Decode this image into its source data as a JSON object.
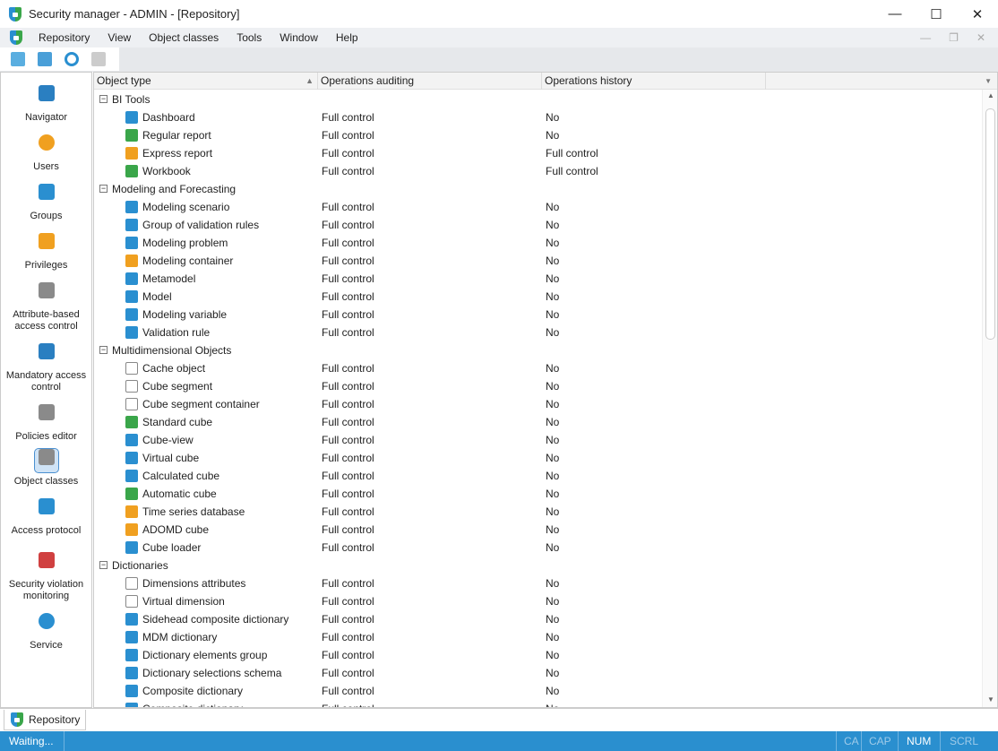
{
  "window": {
    "title": "Security manager - ADMIN - [Repository]",
    "minimize": "—",
    "maximize": "☐",
    "close": "✕"
  },
  "menu": [
    "Repository",
    "View",
    "Object classes",
    "Tools",
    "Window",
    "Help"
  ],
  "mdi": {
    "minimize": "—",
    "restore": "❐",
    "close": "✕"
  },
  "sidebar": [
    {
      "label": "Navigator",
      "icon": "navigator-icon",
      "color": "#2a7fc1"
    },
    {
      "label": "Users",
      "icon": "user-icon",
      "color": "#f0a020"
    },
    {
      "label": "Groups",
      "icon": "groups-icon",
      "color": "#2a8fd0"
    },
    {
      "label": "Privileges",
      "icon": "key-icon",
      "color": "#f0a020"
    },
    {
      "label": "Attribute-based access control",
      "icon": "gear-tag-icon",
      "color": "#8a8a8a"
    },
    {
      "label": "Mandatory access control",
      "icon": "stamp-icon",
      "color": "#2a7fc1"
    },
    {
      "label": "Policies editor",
      "icon": "gear-shield-icon",
      "color": "#8a8a8a"
    },
    {
      "label": "Object classes",
      "icon": "gear-document-icon",
      "color": "#8a8a8a"
    },
    {
      "label": "Access protocol",
      "icon": "log-icon",
      "color": "#2a8fd0"
    },
    {
      "label": "Security violation monitoring",
      "icon": "violation-icon",
      "color": "#d04040"
    },
    {
      "label": "Service",
      "icon": "service-gear-icon",
      "color": "#2a8fd0"
    }
  ],
  "grid": {
    "columns": [
      "Object type",
      "Operations auditing",
      "Operations history"
    ],
    "rows": [
      {
        "group": "BI Tools"
      },
      {
        "name": "Dashboard",
        "audit": "Full control",
        "history": "No",
        "color": "#2a8fd0"
      },
      {
        "name": "Regular report",
        "audit": "Full control",
        "history": "No",
        "color": "#3aa64a"
      },
      {
        "name": "Express report",
        "audit": "Full control",
        "history": "Full control",
        "color": "#f0a020"
      },
      {
        "name": "Workbook",
        "audit": "Full control",
        "history": "Full control",
        "color": "#3aa64a"
      },
      {
        "group": "Modeling and Forecasting"
      },
      {
        "name": "Modeling scenario",
        "audit": "Full control",
        "history": "No",
        "color": "#2a8fd0"
      },
      {
        "name": "Group of validation rules",
        "audit": "Full control",
        "history": "No",
        "color": "#2a8fd0"
      },
      {
        "name": "Modeling problem",
        "audit": "Full control",
        "history": "No",
        "color": "#2a8fd0"
      },
      {
        "name": "Modeling container",
        "audit": "Full control",
        "history": "No",
        "color": "#f0a020"
      },
      {
        "name": "Metamodel",
        "audit": "Full control",
        "history": "No",
        "color": "#2a8fd0"
      },
      {
        "name": "Model",
        "audit": "Full control",
        "history": "No",
        "color": "#2a8fd0"
      },
      {
        "name": "Modeling variable",
        "audit": "Full control",
        "history": "No",
        "color": "#2a8fd0"
      },
      {
        "name": "Validation rule",
        "audit": "Full control",
        "history": "No",
        "color": "#2a8fd0"
      },
      {
        "group": "Multidimensional Objects"
      },
      {
        "name": "Cache object",
        "audit": "Full control",
        "history": "No",
        "color": "#ffffff"
      },
      {
        "name": "Cube segment",
        "audit": "Full control",
        "history": "No",
        "color": "#ffffff"
      },
      {
        "name": "Cube segment container",
        "audit": "Full control",
        "history": "No",
        "color": "#ffffff"
      },
      {
        "name": "Standard cube",
        "audit": "Full control",
        "history": "No",
        "color": "#3aa64a"
      },
      {
        "name": "Cube-view",
        "audit": "Full control",
        "history": "No",
        "color": "#2a8fd0"
      },
      {
        "name": "Virtual cube",
        "audit": "Full control",
        "history": "No",
        "color": "#2a8fd0"
      },
      {
        "name": "Calculated cube",
        "audit": "Full control",
        "history": "No",
        "color": "#2a8fd0"
      },
      {
        "name": "Automatic cube",
        "audit": "Full control",
        "history": "No",
        "color": "#3aa64a"
      },
      {
        "name": "Time series database",
        "audit": "Full control",
        "history": "No",
        "color": "#f0a020"
      },
      {
        "name": "ADOMD cube",
        "audit": "Full control",
        "history": "No",
        "color": "#f0a020"
      },
      {
        "name": "Cube loader",
        "audit": "Full control",
        "history": "No",
        "color": "#2a8fd0"
      },
      {
        "group": "Dictionaries"
      },
      {
        "name": "Dimensions attributes",
        "audit": "Full control",
        "history": "No",
        "color": "#ffffff"
      },
      {
        "name": "Virtual dimension",
        "audit": "Full control",
        "history": "No",
        "color": "#ffffff"
      },
      {
        "name": "Sidehead composite dictionary",
        "audit": "Full control",
        "history": "No",
        "color": "#2a8fd0"
      },
      {
        "name": "MDM dictionary",
        "audit": "Full control",
        "history": "No",
        "color": "#2a8fd0"
      },
      {
        "name": "Dictionary elements group",
        "audit": "Full control",
        "history": "No",
        "color": "#2a8fd0"
      },
      {
        "name": "Dictionary selections schema",
        "audit": "Full control",
        "history": "No",
        "color": "#2a8fd0"
      },
      {
        "name": "Composite dictionary",
        "audit": "Full control",
        "history": "No",
        "color": "#2a8fd0"
      },
      {
        "name": "Composite dictionary",
        "audit": "Full control",
        "history": "No",
        "color": "#2a8fd0"
      }
    ]
  },
  "tab": {
    "label": "Repository"
  },
  "status": {
    "text": "Waiting...",
    "caps": "CA",
    "cap": "CAP",
    "num": "NUM",
    "scrl": "SCRL"
  }
}
